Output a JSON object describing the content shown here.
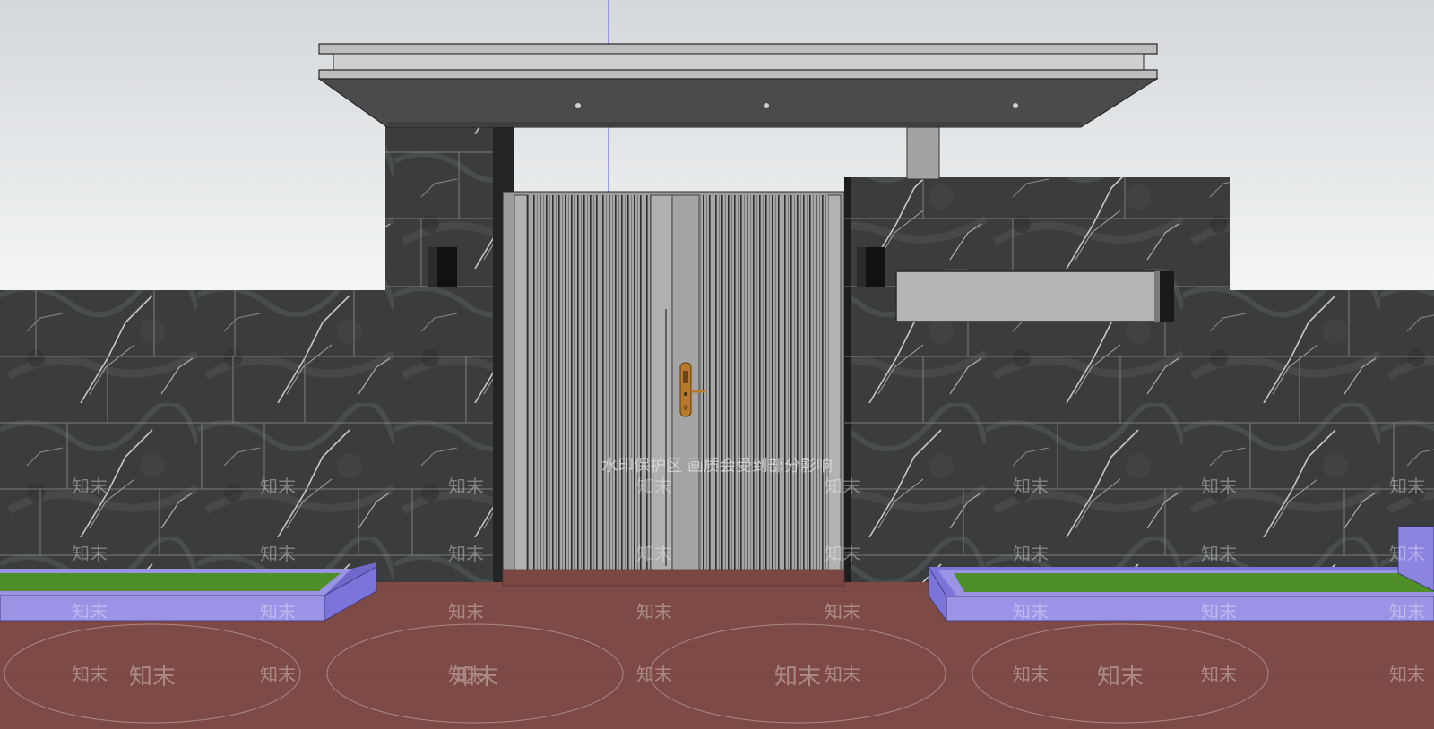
{
  "scene": {
    "subject": "courtyard-entrance-gate-3d-model",
    "colors": {
      "sky_top": "#d6d9dc",
      "sky_bottom": "#f2f4f5",
      "marble": "#3b3d3e",
      "marble_vein": "#cfcfcf",
      "gate": "#a9a9a9",
      "canopy": "#4a4b4c",
      "planter_edge": "#9a93e6",
      "lawn": "#4f8f2a",
      "ground": "#7e4a45",
      "lock": "#b87a2a"
    }
  },
  "watermark": {
    "notice": "水印保护区  画质会受到部分影响",
    "brand": "知末"
  }
}
